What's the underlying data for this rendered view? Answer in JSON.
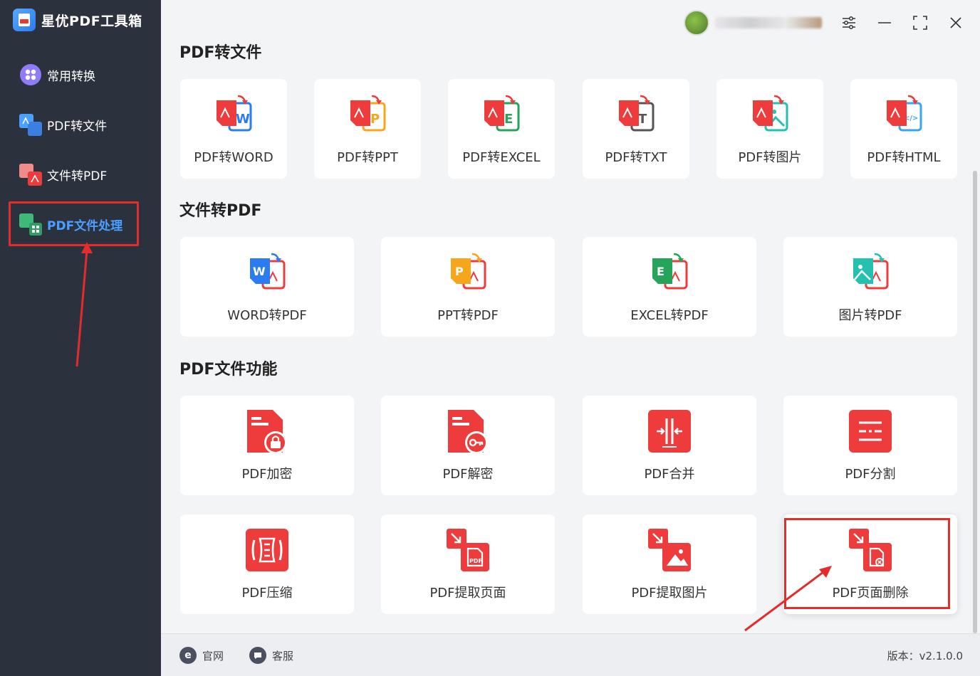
{
  "app": {
    "title": "星优PDF工具箱"
  },
  "sidebar": {
    "items": [
      {
        "label": "常用转换"
      },
      {
        "label": "PDF转文件"
      },
      {
        "label": "文件转PDF"
      },
      {
        "label": "PDF文件处理"
      }
    ]
  },
  "sections": [
    {
      "title": "PDF转文件",
      "cards": [
        "PDF转WORD",
        "PDF转PPT",
        "PDF转EXCEL",
        "PDF转TXT",
        "PDF转图片",
        "PDF转HTML"
      ]
    },
    {
      "title": "文件转PDF",
      "cards": [
        "WORD转PDF",
        "PPT转PDF",
        "EXCEL转PDF",
        "图片转PDF"
      ]
    },
    {
      "title": "PDF文件功能",
      "cards": [
        "PDF加密",
        "PDF解密",
        "PDF合并",
        "PDF分割",
        "PDF压缩",
        "PDF提取页面",
        "PDF提取图片",
        "PDF页面删除"
      ]
    }
  ],
  "footer": {
    "site": "官网",
    "service": "客服",
    "version": "版本：v2.1.0.0"
  },
  "colors": {
    "sidebar_bg": "#2c323d",
    "accent": "#4aa0ff",
    "highlight": "#e52b2b",
    "pdf_red": "#ee3b3b"
  },
  "icons": {
    "pdf_to": [
      "pdf-to-word-icon",
      "pdf-to-ppt-icon",
      "pdf-to-excel-icon",
      "pdf-to-txt-icon",
      "pdf-to-image-icon",
      "pdf-to-html-icon"
    ],
    "to_pdf": [
      "word-to-pdf-icon",
      "ppt-to-pdf-icon",
      "excel-to-pdf-icon",
      "image-to-pdf-icon"
    ],
    "functions": [
      "lock-icon",
      "key-icon",
      "merge-icon",
      "split-icon",
      "compress-icon",
      "extract-page-icon",
      "extract-image-icon",
      "delete-page-icon"
    ]
  }
}
